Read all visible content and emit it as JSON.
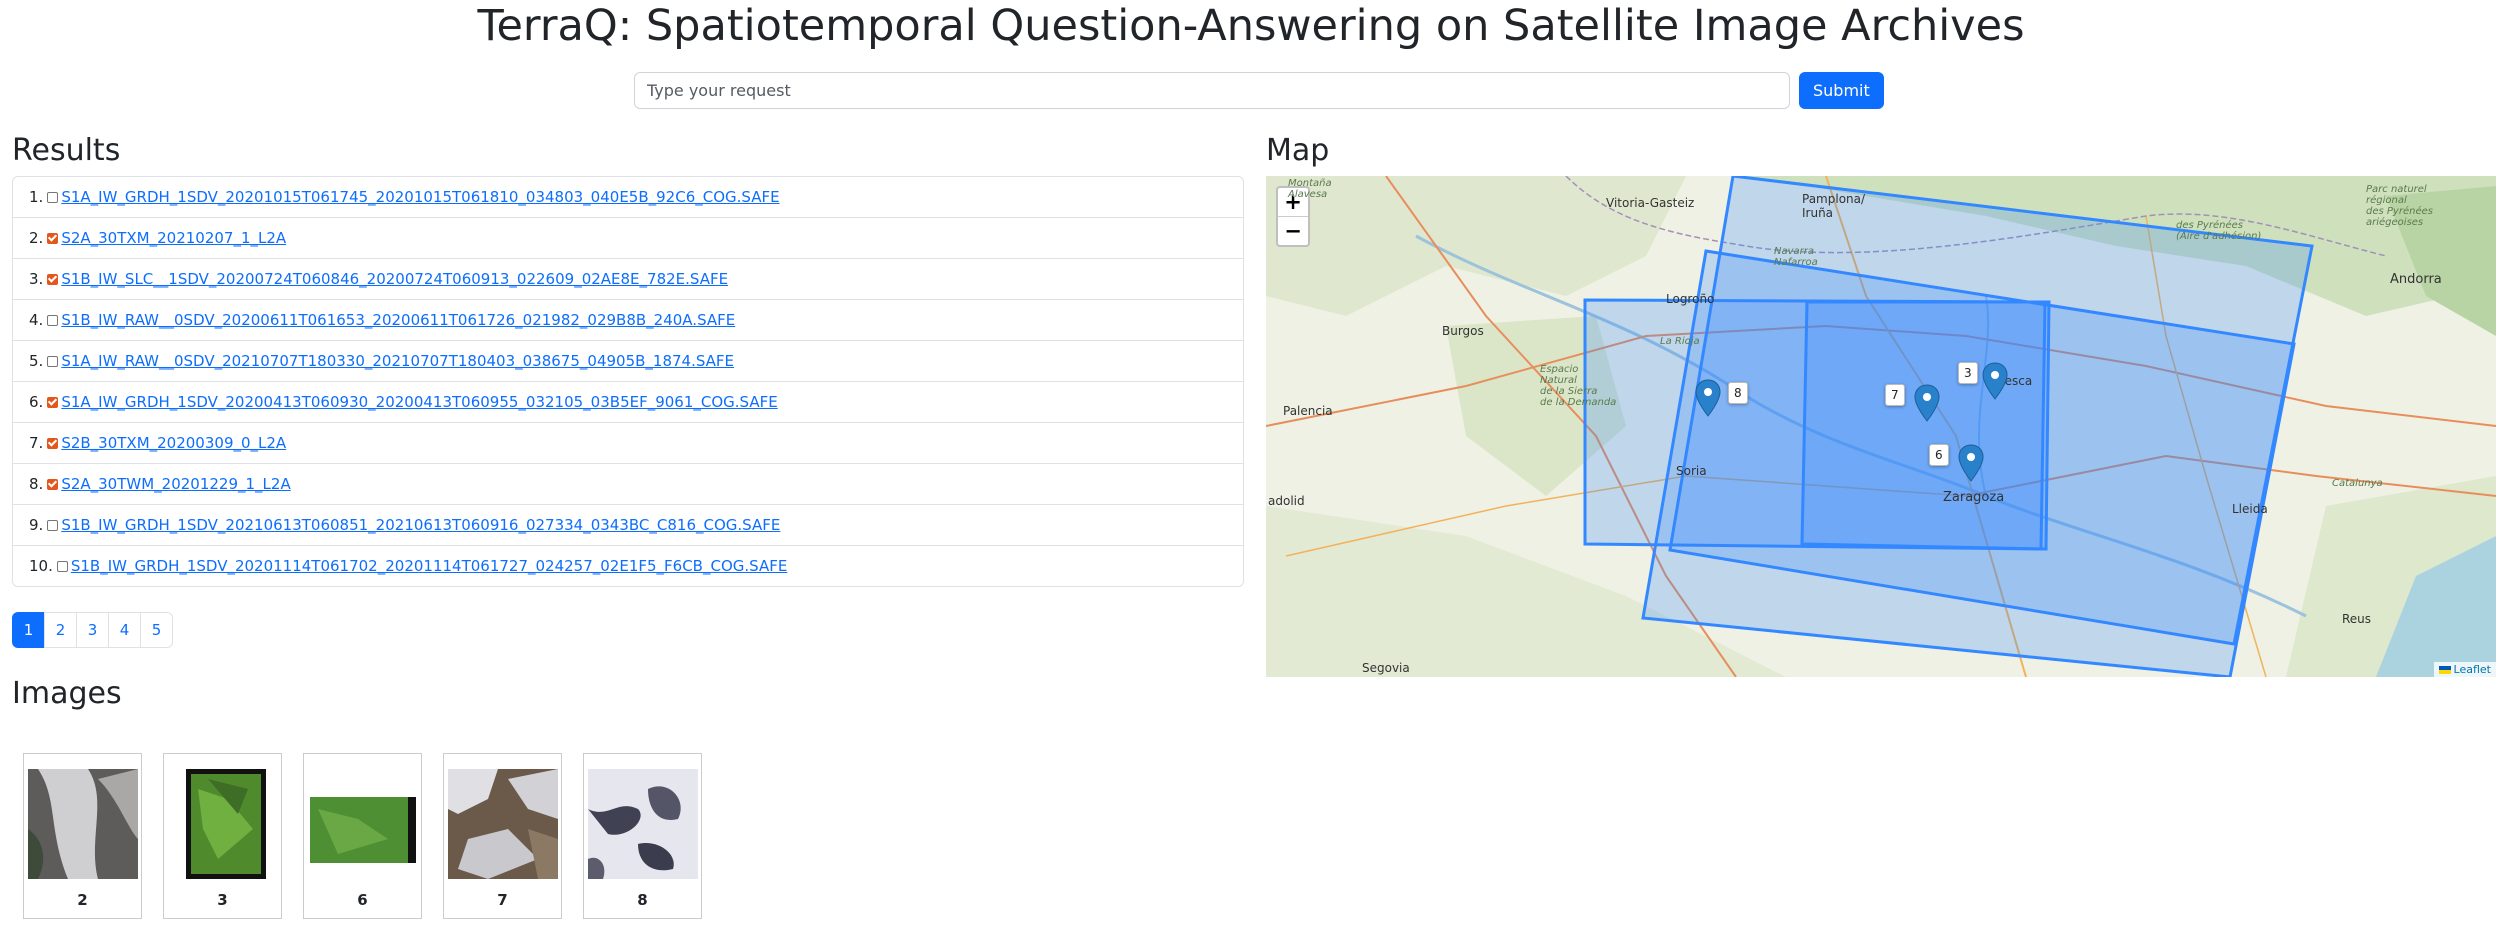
{
  "app": {
    "title": "TerraQ: Spatiotemporal Question-Answering on Satellite Image Archives"
  },
  "search": {
    "placeholder": "Type your request",
    "value": "",
    "submit_label": "Submit"
  },
  "results": {
    "heading": "Results",
    "items": [
      {
        "num": "1.",
        "checked": false,
        "name": "S1A_IW_GRDH_1SDV_20201015T061745_20201015T061810_034803_040E5B_92C6_COG.SAFE"
      },
      {
        "num": "2.",
        "checked": true,
        "name": "S2A_30TXM_20210207_1_L2A"
      },
      {
        "num": "3.",
        "checked": true,
        "name": "S1B_IW_SLC__1SDV_20200724T060846_20200724T060913_022609_02AE8E_782E.SAFE"
      },
      {
        "num": "4.",
        "checked": false,
        "name": "S1B_IW_RAW__0SDV_20200611T061653_20200611T061726_021982_029B8B_240A.SAFE"
      },
      {
        "num": "5.",
        "checked": false,
        "name": "S1A_IW_RAW__0SDV_20210707T180330_20210707T180403_038675_04905B_1874.SAFE"
      },
      {
        "num": "6.",
        "checked": true,
        "name": "S1A_IW_GRDH_1SDV_20200413T060930_20200413T060955_032105_03B5EF_9061_COG.SAFE"
      },
      {
        "num": "7.",
        "checked": true,
        "name": "S2B_30TXM_20200309_0_L2A"
      },
      {
        "num": "8.",
        "checked": true,
        "name": "S2A_30TWM_20201229_1_L2A"
      },
      {
        "num": "9.",
        "checked": false,
        "name": "S1B_IW_GRDH_1SDV_20210613T060851_20210613T060916_027334_0343BC_C816_COG.SAFE"
      },
      {
        "num": "10.",
        "checked": false,
        "name": "S1B_IW_GRDH_1SDV_20201114T061702_20201114T061727_024257_02E1F5_F6CB_COG.SAFE"
      }
    ]
  },
  "pagination": {
    "pages": [
      "1",
      "2",
      "3",
      "4",
      "5"
    ],
    "active": "1"
  },
  "map": {
    "heading": "Map",
    "zoom_in": "+",
    "zoom_out": "−",
    "attribution": "Leaflet",
    "labels": {
      "vitoria": "Vitoria-Gasteiz",
      "pamplona": "Pamplona/\nIruña",
      "navarra": "Navarra\nNafarroa",
      "logrono": "Logroño",
      "burgos": "Burgos",
      "la_rioja": "La Rioja",
      "espacio_natural": "Espacio\nNatural\nde la Sierra\nde la Demanda",
      "palencia": "Palencia",
      "soria": "Soria",
      "huesca": "Huesca",
      "zaragoza": "Zaragoza",
      "lleida": "Lleida",
      "catalunya": "Catalunya",
      "andorra": "Andorra",
      "pyrenees_1": "des Pyrénées\n(Aire d'adhésion)",
      "pyrenees_2": "Parc naturel\nrégional\ndes Pyrénées\nariégeoises",
      "montana": "Montaña\nAlavesa",
      "segovia": "Segovia",
      "valladolid": "adolid",
      "reus": "Reus"
    },
    "markers": [
      "8",
      "7",
      "3",
      "6"
    ],
    "accent_color": "#3388ff"
  },
  "images": {
    "heading": "Images",
    "items": [
      {
        "label": "2"
      },
      {
        "label": "3"
      },
      {
        "label": "6"
      },
      {
        "label": "7"
      },
      {
        "label": "8"
      }
    ]
  }
}
